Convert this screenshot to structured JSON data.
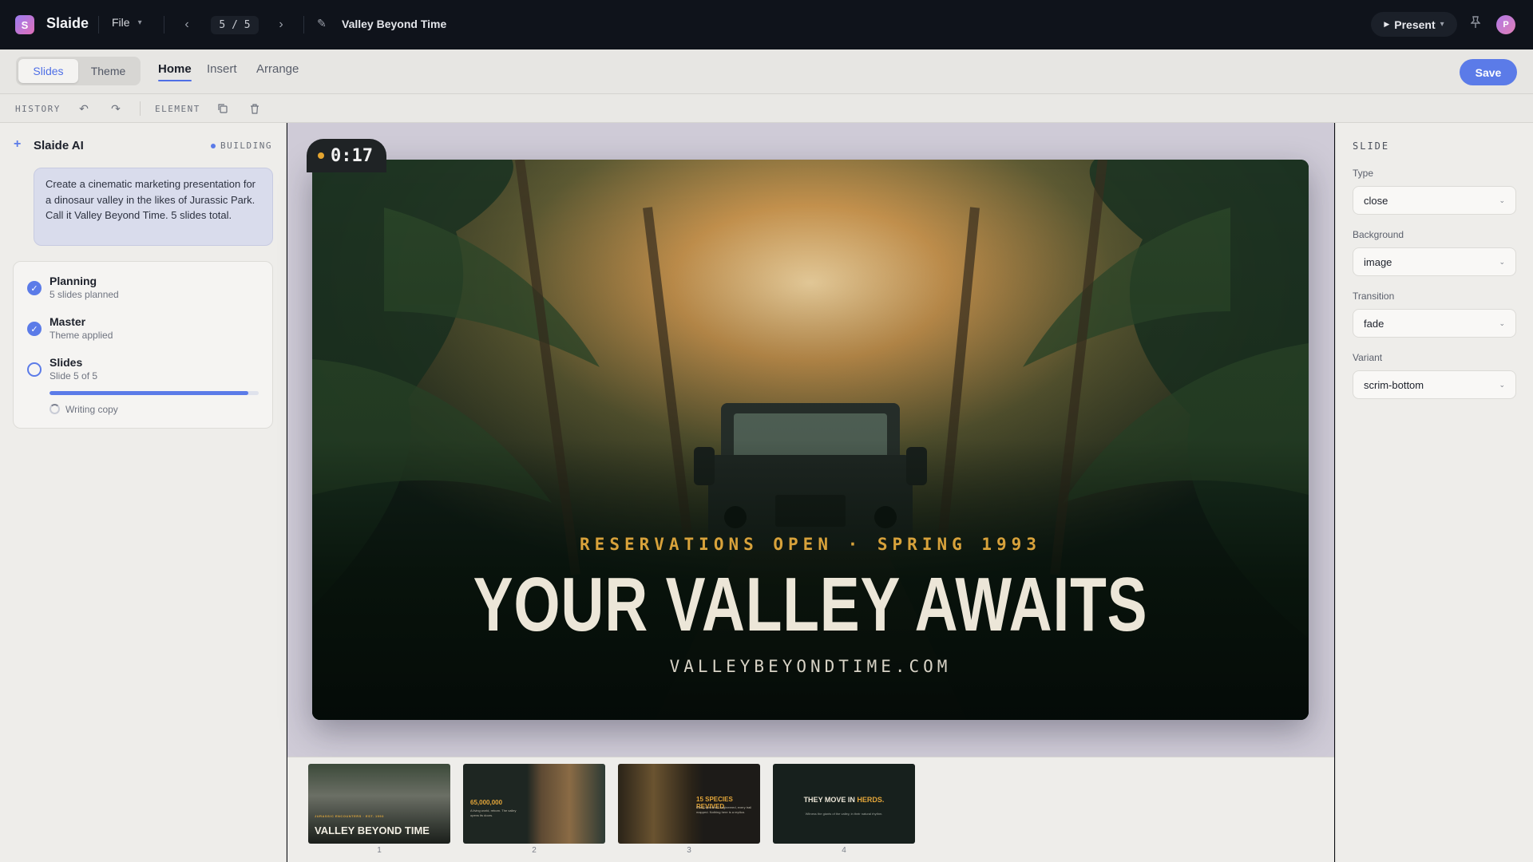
{
  "app": {
    "logo_letter": "S",
    "name": "Slaide",
    "file_label": "File"
  },
  "nav": {
    "page_indicator": "5 / 5",
    "doc_title": "Valley Beyond Time"
  },
  "top_right": {
    "present_label": "Present",
    "avatar_letter": "P"
  },
  "ribbon": {
    "modes": [
      "Slides",
      "Theme"
    ],
    "active_mode": "Slides",
    "tabs": [
      "Home",
      "Insert",
      "Arrange"
    ],
    "active_tab": "Home",
    "save_label": "Save"
  },
  "toolbar": {
    "history_label": "HISTORY",
    "element_label": "ELEMENT"
  },
  "ai_panel": {
    "title": "Slaide AI",
    "status": "BUILDING",
    "prompt": "Create a cinematic marketing presentation for a dinosaur valley in the likes of Jurassic Park. Call it Valley Beyond Time. 5 slides total.",
    "steps": [
      {
        "name": "Planning",
        "detail": "5 slides planned",
        "done": true
      },
      {
        "name": "Master",
        "detail": "Theme applied",
        "done": true
      },
      {
        "name": "Slides",
        "detail": "Slide 5 of 5",
        "done": false
      }
    ],
    "progress": 0.95,
    "current_task": "Writing copy"
  },
  "slide": {
    "timer": "0:17",
    "kicker": "RESERVATIONS OPEN · SPRING 1993",
    "headline": "YOUR VALLEY AWAITS",
    "url": "VALLEYBEYONDTIME.COM"
  },
  "filmstrip": [
    {
      "number": "1",
      "text": "VALLEY BEYOND TIME",
      "small": "JURASSIC ENCOUNTERS · EST. 1993"
    },
    {
      "number": "2",
      "text": "65,000,000",
      "small": "A living world, reborn. The valley opens its doors."
    },
    {
      "number": "3",
      "text": "15 SPECIES REVIVED",
      "small": "Every specimen engineered, every trail mapped. Nothing here is a replica."
    },
    {
      "number": "4",
      "text_prefix": "THEY MOVE IN ",
      "text_accent": "HERDS.",
      "small": "Witness the giants of the valley, in their natural rhythm."
    }
  ],
  "properties": {
    "title": "SLIDE",
    "fields": [
      {
        "label": "Type",
        "value": "close"
      },
      {
        "label": "Background",
        "value": "image"
      },
      {
        "label": "Transition",
        "value": "fade"
      },
      {
        "label": "Variant",
        "value": "scrim-bottom"
      }
    ]
  },
  "colors": {
    "accent": "#5b7be8",
    "kicker_gold": "#d8a23b",
    "headline_cream": "#ece6d8",
    "topbar": "#0f131b"
  }
}
